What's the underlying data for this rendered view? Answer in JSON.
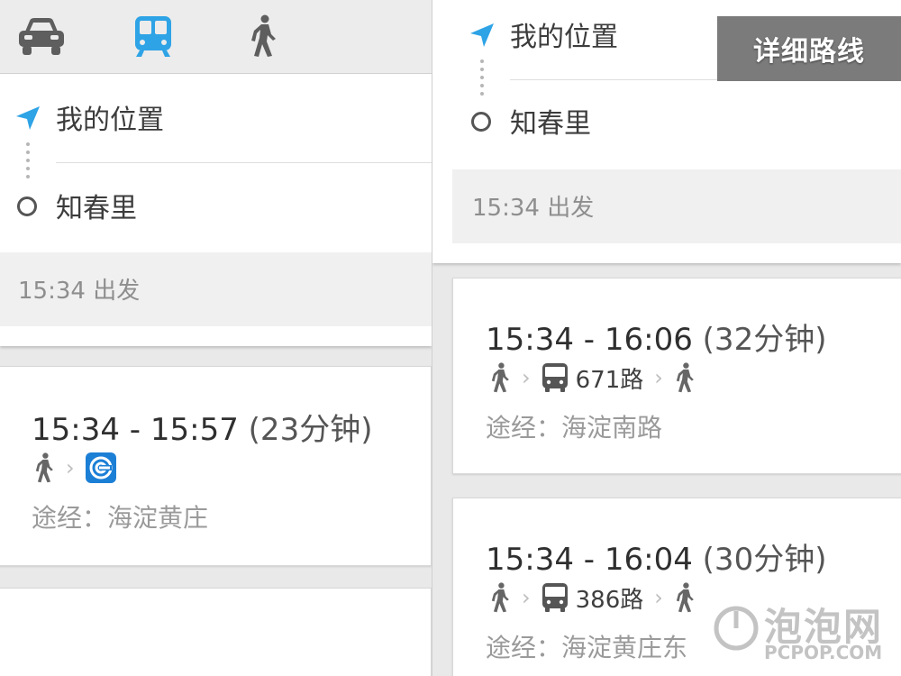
{
  "mode_tabs": [
    {
      "icon": "car-icon",
      "active": false
    },
    {
      "icon": "transit-icon",
      "active": true
    },
    {
      "icon": "walk-icon",
      "active": false
    }
  ],
  "route": {
    "origin": "我的位置",
    "destination": "知春里",
    "depart": "15:34 出发"
  },
  "options_left": [
    {
      "time": "15:34 - 15:57",
      "duration": "(23分钟)",
      "via": "途经：海淀黄庄",
      "steps": [
        "walk-icon",
        "subway-logo-icon"
      ]
    }
  ],
  "options_right": [
    {
      "time": "15:34 - 16:06",
      "duration": "(32分钟)",
      "line": "671路",
      "via": "途经：海淀南路",
      "steps": [
        "walk-icon",
        "bus-icon",
        "walk-icon"
      ]
    },
    {
      "time": "15:34 - 16:04",
      "duration": "(30分钟)",
      "line": "386路",
      "via": "途经：海淀黄庄东",
      "steps": [
        "walk-icon",
        "bus-icon",
        "walk-icon"
      ]
    }
  ],
  "step_separator": "›",
  "banner": "详细路线",
  "watermark": {
    "cn": "泡泡网",
    "en": "PCPOP.COM"
  },
  "colors": {
    "accent": "#2ea3e6",
    "text": "#333333",
    "muted": "#999999"
  }
}
